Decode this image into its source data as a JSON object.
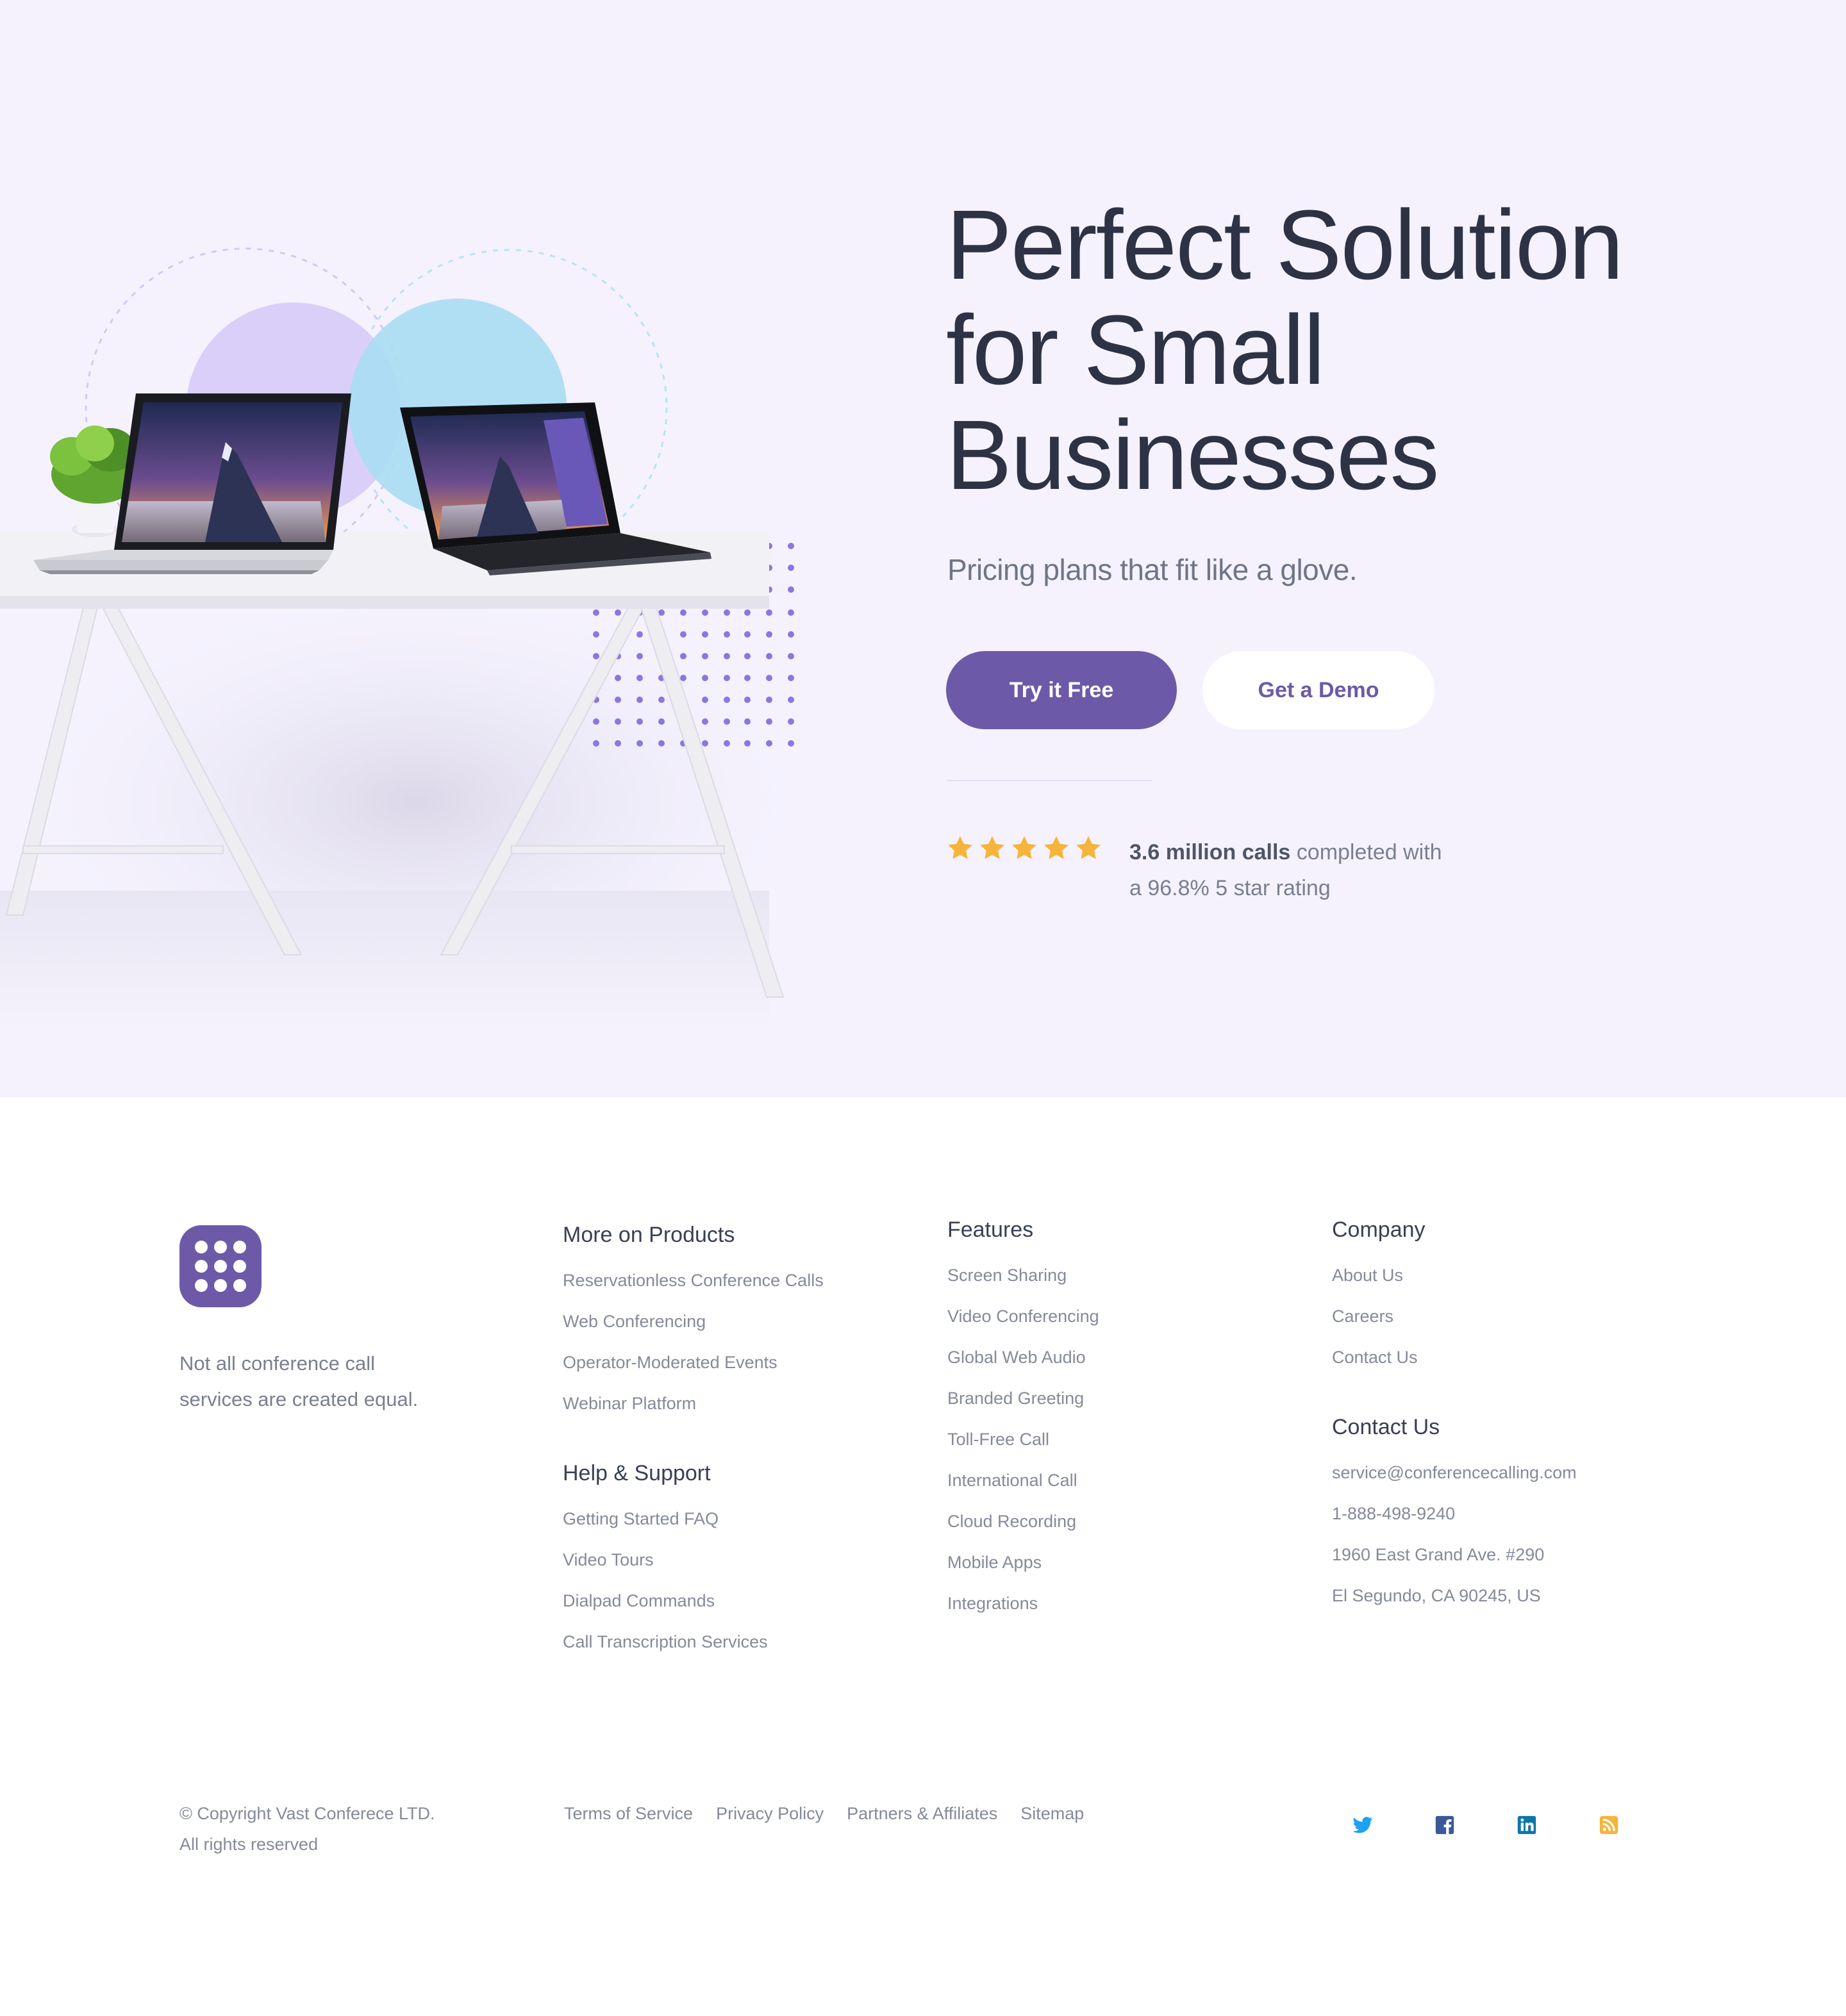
{
  "hero": {
    "title_line1": "Perfect Solution",
    "title_line2": "for Small",
    "title_line3": "Businesses",
    "subtitle": "Pricing plans that fit like a glove.",
    "primary_button": "Try it Free",
    "secondary_button": "Get a Demo",
    "rating": {
      "stars": 5,
      "highlight": "3.6 million calls",
      "text_rest": " completed with",
      "text_line2": "a 96.8% 5 star rating"
    },
    "colors": {
      "accent": "#6c5aa8",
      "star": "#f6b43c",
      "background": "#f5f2fe"
    }
  },
  "footer": {
    "logo_icon": "keypad-icon",
    "tagline_line1": "Not all conference call",
    "tagline_line2": "services are created equal.",
    "products": {
      "title": "More on Products",
      "links": [
        "Reservationless Conference Calls",
        "Web Conferencing",
        "Operator-Moderated Events",
        "Webinar Platform"
      ]
    },
    "help": {
      "title": "Help & Support",
      "links": [
        "Getting Started FAQ",
        "Video Tours",
        "Dialpad Commands",
        "Call Transcription Services"
      ]
    },
    "features": {
      "title": "Features",
      "links": [
        "Screen Sharing",
        "Video Conferencing",
        "Global Web Audio",
        "Branded Greeting",
        "Toll-Free Call",
        "International Call",
        "Cloud Recording",
        "Mobile Apps",
        "Integrations"
      ]
    },
    "company": {
      "title": "Company",
      "links": [
        "About Us",
        "Careers",
        "Contact Us"
      ]
    },
    "contact": {
      "title": "Contact Us",
      "lines": [
        "service@conferencecalling.com",
        "1-888-498-9240",
        "1960 East Grand Ave. #290",
        "El Segundo, CA 90245, US"
      ]
    },
    "copyright_line1": "© Copyright Vast Conferece LTD.",
    "copyright_line2": "All rights reserved",
    "bottom_links": [
      "Terms of Service",
      "Privacy Policy",
      "Partners & Affiliates",
      "Sitemap"
    ],
    "social": [
      {
        "icon": "twitter-icon",
        "color": "#1da1f2",
        "bg": "#e1f1fc"
      },
      {
        "icon": "facebook-icon",
        "color": "#3b5998",
        "bg": "#e6e7f2"
      },
      {
        "icon": "linkedin-icon",
        "color": "#0e76a8",
        "bg": "#e0eaf2"
      },
      {
        "icon": "rss-icon",
        "color": "#f6b43c",
        "bg": "#fdf3e3"
      }
    ]
  }
}
